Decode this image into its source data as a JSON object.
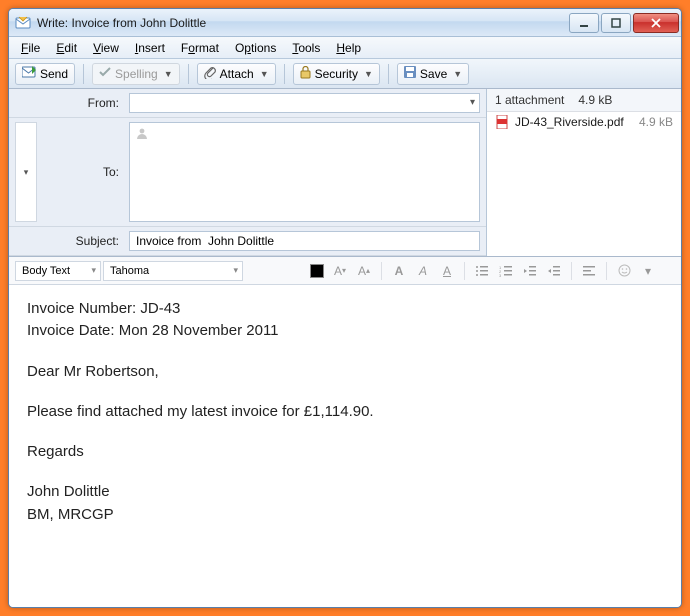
{
  "window": {
    "title": "Write: Invoice from John Dolittle"
  },
  "menu": {
    "file": "File",
    "edit": "Edit",
    "view": "View",
    "insert": "Insert",
    "format": "Format",
    "options": "Options",
    "tools": "Tools",
    "help": "Help"
  },
  "toolbar": {
    "send": "Send",
    "spelling": "Spelling",
    "attach": "Attach",
    "security": "Security",
    "save": "Save"
  },
  "fields": {
    "from_label": "From:",
    "from_value": "",
    "to_label": "To:",
    "to_value": "",
    "subject_label": "Subject:",
    "subject_value": "Invoice from  John Dolittle"
  },
  "attachments": {
    "count_label": "1 attachment",
    "total_size": "4.9 kB",
    "items": [
      {
        "name": "JD-43_Riverside.pdf",
        "size": "4.9 kB"
      }
    ]
  },
  "format": {
    "style": "Body Text",
    "font": "Tahoma"
  },
  "body": {
    "l1": "Invoice Number: JD-43",
    "l2": "Invoice Date: Mon 28 November 2011",
    "l3": "Dear Mr Robertson,",
    "l4": "Please find attached my latest invoice for £1,114.90.",
    "l5": "Regards",
    "l6": "John Dolittle",
    "l7": "BM, MRCGP"
  }
}
